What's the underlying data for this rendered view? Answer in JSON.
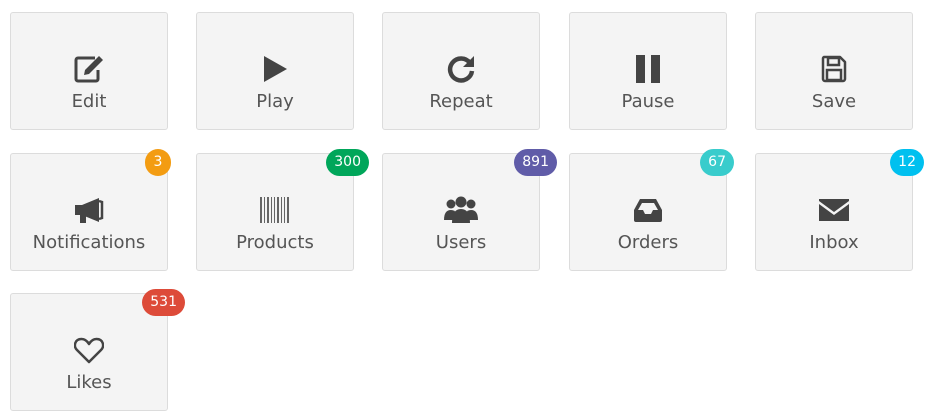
{
  "tiles_row1": [
    {
      "label": "Edit",
      "icon": "edit-icon"
    },
    {
      "label": "Play",
      "icon": "play-icon"
    },
    {
      "label": "Repeat",
      "icon": "repeat-icon"
    },
    {
      "label": "Pause",
      "icon": "pause-icon"
    },
    {
      "label": "Save",
      "icon": "save-icon"
    }
  ],
  "tiles_row2": [
    {
      "label": "Notifications",
      "icon": "bullhorn-icon",
      "badge": "3",
      "badge_color": "#f39c12"
    },
    {
      "label": "Products",
      "icon": "barcode-icon",
      "badge": "300",
      "badge_color": "#00a65a"
    },
    {
      "label": "Users",
      "icon": "users-icon",
      "badge": "891",
      "badge_color": "#605ca8"
    },
    {
      "label": "Orders",
      "icon": "inbox-tray-icon",
      "badge": "67",
      "badge_color": "#39cccc"
    },
    {
      "label": "Inbox",
      "icon": "envelope-icon",
      "badge": "12",
      "badge_color": "#00c0ef"
    }
  ],
  "tiles_row3": [
    {
      "label": "Likes",
      "icon": "heart-outline-icon",
      "badge": "531",
      "badge_color": "#dd4b39"
    }
  ]
}
